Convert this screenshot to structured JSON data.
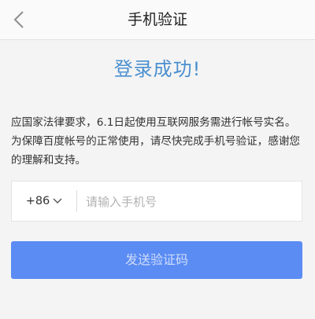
{
  "nav": {
    "title": "手机验证",
    "back_icon": "chevron-left-icon"
  },
  "main": {
    "success_title": "登录成功!",
    "notice": "应国家法律要求，6.1日起使用互联网服务需进行帐号实名。为保障百度帐号的正常使用，请尽快完成手机号验证，感谢您的理解和支持。"
  },
  "form": {
    "country_code": "+86",
    "country_code_icon": "chevron-down-icon",
    "phone_placeholder": "请输入手机号",
    "phone_value": "",
    "send_button_label": "发送验证码"
  },
  "colors": {
    "accent": "#5a8cf3",
    "success_text": "#4a8fcf",
    "background": "#f4f4f4"
  }
}
